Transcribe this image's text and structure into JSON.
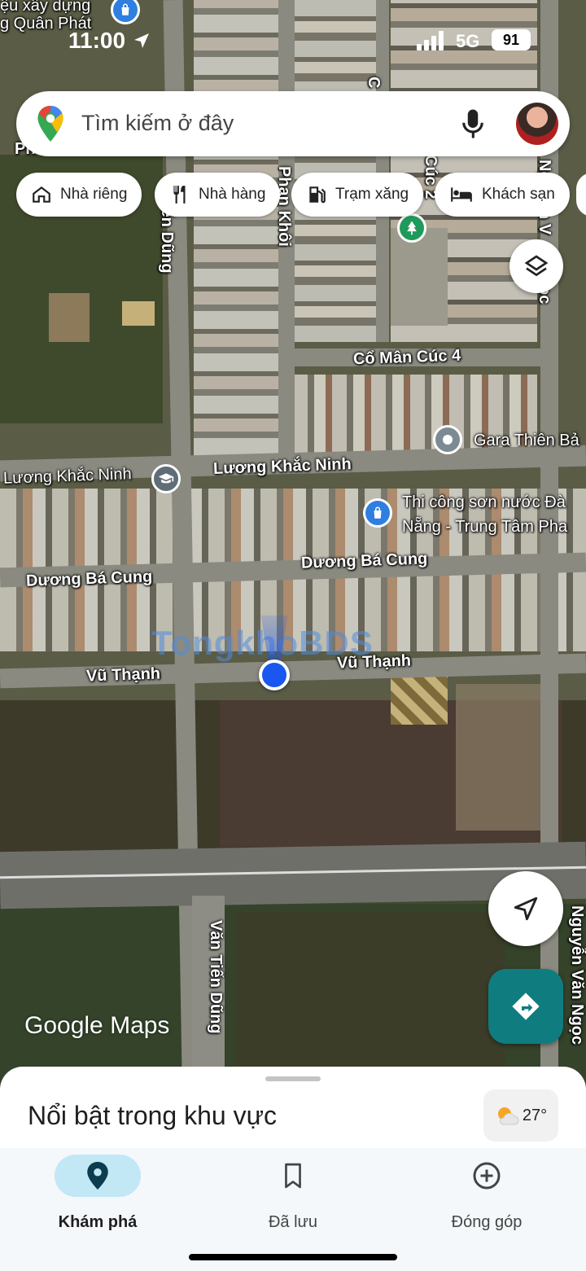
{
  "status_bar": {
    "time": "11:00",
    "network": "5G",
    "battery": "91"
  },
  "search": {
    "placeholder": "Tìm kiếm ở đây"
  },
  "chips": [
    {
      "label": "Nhà riêng",
      "icon": "home-icon"
    },
    {
      "label": "Nhà hàng",
      "icon": "restaurant-icon"
    },
    {
      "label": "Trạm xăng",
      "icon": "gas-station-icon"
    },
    {
      "label": "Khách sạn",
      "icon": "hotel-icon"
    }
  ],
  "map": {
    "streets": {
      "cuc4": "Cổ Mân Cúc 4",
      "luong_left": "Lương Khắc Ninh",
      "luong_right": "Lương Khắc Ninh",
      "duong_left": "Dương Bá Cung",
      "duong_right": "Dương Bá Cung",
      "vu_left": "Vũ Thạnh",
      "vu_right": "Vũ Thạnh",
      "tien_dung_top": "iến Dũng",
      "tien_dung_bottom": "Văn Tiến Dũng",
      "phan_khoi": "Phan Khôi",
      "nguyen_van_ngoc": "Nguyễn Văn Ngọc",
      "nguyen_top": "Nguyễn V",
      "ngoc_top": "ọc",
      "co_top": "C",
      "cuc2": "Cúc 2",
      "ph": "Ph"
    },
    "pois": {
      "top_left_line1": "ệu xây dựng",
      "top_left_line2": "g Quân Phát",
      "gara": "Gara Thiên Bả",
      "thi_cong_line1": "Thi công sơn nước Đà",
      "thi_cong_line2": "Nẵng - Trung Tâm Pha"
    },
    "watermark": "TongkhoBDS",
    "logo": "Google Maps"
  },
  "sheet": {
    "title": "Nổi bật trong khu vực",
    "temperature": "27°"
  },
  "nav": [
    {
      "label": "Khám phá",
      "icon": "explore-pin-icon",
      "active": true
    },
    {
      "label": "Đã lưu",
      "icon": "bookmark-icon",
      "active": false
    },
    {
      "label": "Đóng góp",
      "icon": "add-circle-icon",
      "active": false
    }
  ],
  "colors": {
    "accent": "#0f7c80",
    "active_nav_bg": "#c2e7f5",
    "location_dot": "#1a57f0"
  }
}
